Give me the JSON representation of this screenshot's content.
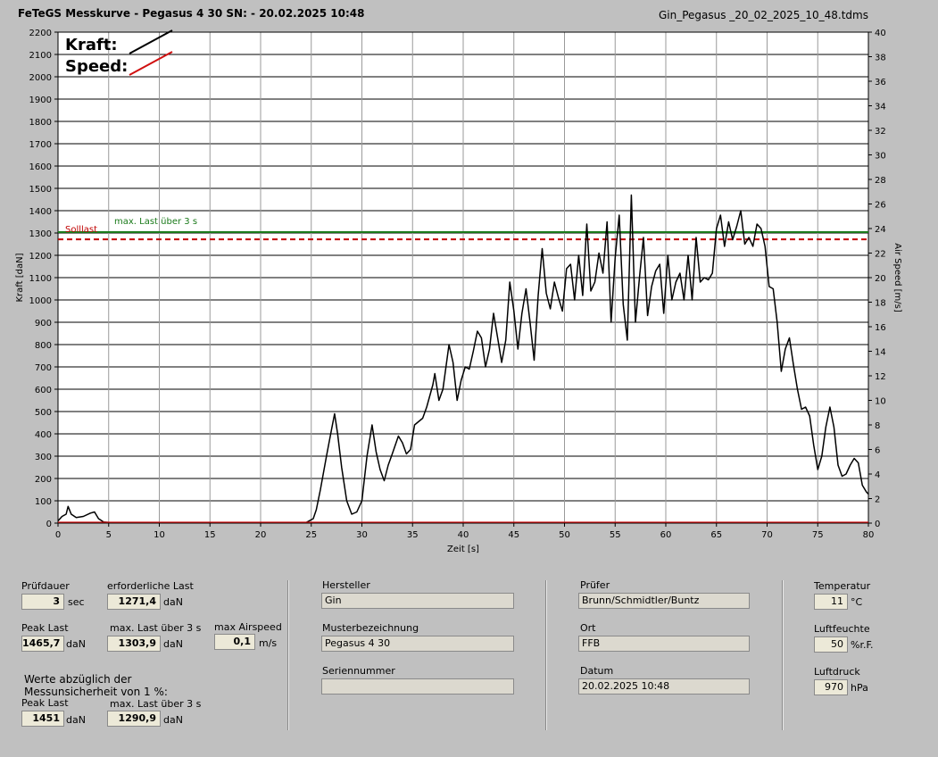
{
  "header": {
    "title": "FeTeGS Messkurve - Pegasus 4 30  SN:  - 20.02.2025 10:48",
    "filename": "Gin_Pegasus _20_02_2025_10_48.tdms"
  },
  "chart_data": {
    "type": "line",
    "xlabel": "Zeit [s]",
    "ylabel_left": "Kraft [daN]",
    "ylabel_right": "Air Speed [m/s]",
    "xlim": [
      0,
      80
    ],
    "ylim_left": [
      0,
      2200
    ],
    "ylim_right": [
      0,
      40
    ],
    "xticks": [
      "0",
      "5",
      "10",
      "15",
      "20",
      "25",
      "30",
      "35",
      "40",
      "45",
      "50",
      "55",
      "60",
      "65",
      "70",
      "75",
      "80"
    ],
    "yticks_left": [
      "0",
      "100",
      "200",
      "300",
      "400",
      "500",
      "600",
      "700",
      "800",
      "900",
      "1000",
      "1100",
      "1200",
      "1300",
      "1400",
      "1500",
      "1600",
      "1700",
      "1800",
      "1900",
      "2000",
      "2100",
      "2200"
    ],
    "yticks_right": [
      "0",
      "2",
      "4",
      "6",
      "8",
      "10",
      "12",
      "14",
      "16",
      "18",
      "20",
      "22",
      "24",
      "26",
      "28",
      "30",
      "32",
      "34",
      "36",
      "38",
      "40"
    ],
    "legend": [
      {
        "name": "Kraft:",
        "color": "#000000"
      },
      {
        "name": "Speed:",
        "color": "#d01010"
      }
    ],
    "legend_position": "top-left",
    "grid": true,
    "series": [
      {
        "name": "Kraft",
        "color": "#000000",
        "points": [
          [
            0,
            10
          ],
          [
            0.4,
            30
          ],
          [
            0.8,
            40
          ],
          [
            1.0,
            75
          ],
          [
            1.3,
            40
          ],
          [
            1.8,
            25
          ],
          [
            2.5,
            30
          ],
          [
            3.2,
            45
          ],
          [
            3.6,
            50
          ],
          [
            4.0,
            20
          ],
          [
            4.5,
            5
          ],
          [
            5,
            3
          ],
          [
            10,
            3
          ],
          [
            15,
            3
          ],
          [
            20,
            3
          ],
          [
            24.5,
            3
          ],
          [
            25.2,
            20
          ],
          [
            25.5,
            60
          ],
          [
            25.9,
            150
          ],
          [
            26.5,
            300
          ],
          [
            27.0,
            420
          ],
          [
            27.3,
            490
          ],
          [
            27.6,
            400
          ],
          [
            28.0,
            250
          ],
          [
            28.5,
            100
          ],
          [
            29.0,
            40
          ],
          [
            29.5,
            50
          ],
          [
            30.0,
            100
          ],
          [
            30.5,
            300
          ],
          [
            31.0,
            440
          ],
          [
            31.4,
            320
          ],
          [
            31.8,
            240
          ],
          [
            32.2,
            190
          ],
          [
            32.6,
            260
          ],
          [
            33.0,
            310
          ],
          [
            33.6,
            390
          ],
          [
            34.0,
            360
          ],
          [
            34.4,
            310
          ],
          [
            34.8,
            330
          ],
          [
            35.2,
            440
          ],
          [
            36.0,
            470
          ],
          [
            36.4,
            520
          ],
          [
            37.0,
            620
          ],
          [
            37.2,
            670
          ],
          [
            37.6,
            550
          ],
          [
            38.0,
            600
          ],
          [
            38.6,
            800
          ],
          [
            39.0,
            720
          ],
          [
            39.4,
            550
          ],
          [
            39.8,
            640
          ],
          [
            40.2,
            700
          ],
          [
            40.6,
            690
          ],
          [
            41.0,
            770
          ],
          [
            41.4,
            860
          ],
          [
            41.8,
            830
          ],
          [
            42.2,
            700
          ],
          [
            42.6,
            780
          ],
          [
            43.0,
            940
          ],
          [
            43.4,
            830
          ],
          [
            43.8,
            720
          ],
          [
            44.2,
            820
          ],
          [
            44.6,
            1080
          ],
          [
            45.0,
            950
          ],
          [
            45.4,
            780
          ],
          [
            45.8,
            940
          ],
          [
            46.2,
            1050
          ],
          [
            46.6,
            900
          ],
          [
            47.0,
            730
          ],
          [
            47.4,
            1020
          ],
          [
            47.8,
            1230
          ],
          [
            48.2,
            1030
          ],
          [
            48.6,
            960
          ],
          [
            49.0,
            1080
          ],
          [
            49.4,
            1010
          ],
          [
            49.8,
            950
          ],
          [
            50.2,
            1140
          ],
          [
            50.6,
            1160
          ],
          [
            51.0,
            1000
          ],
          [
            51.4,
            1200
          ],
          [
            51.8,
            1020
          ],
          [
            52.2,
            1340
          ],
          [
            52.6,
            1040
          ],
          [
            53.0,
            1080
          ],
          [
            53.4,
            1210
          ],
          [
            53.8,
            1120
          ],
          [
            54.2,
            1350
          ],
          [
            54.6,
            900
          ],
          [
            55.0,
            1190
          ],
          [
            55.4,
            1380
          ],
          [
            55.8,
            980
          ],
          [
            56.2,
            820
          ],
          [
            56.6,
            1470
          ],
          [
            57.0,
            900
          ],
          [
            57.4,
            1100
          ],
          [
            57.8,
            1280
          ],
          [
            58.2,
            930
          ],
          [
            58.6,
            1060
          ],
          [
            59.0,
            1130
          ],
          [
            59.4,
            1160
          ],
          [
            59.8,
            940
          ],
          [
            60.2,
            1200
          ],
          [
            60.6,
            1000
          ],
          [
            61.0,
            1080
          ],
          [
            61.4,
            1120
          ],
          [
            61.8,
            1000
          ],
          [
            62.2,
            1200
          ],
          [
            62.6,
            1000
          ],
          [
            63.0,
            1280
          ],
          [
            63.4,
            1080
          ],
          [
            63.8,
            1100
          ],
          [
            64.2,
            1090
          ],
          [
            64.6,
            1120
          ],
          [
            65.0,
            1320
          ],
          [
            65.4,
            1380
          ],
          [
            65.8,
            1240
          ],
          [
            66.2,
            1350
          ],
          [
            66.6,
            1270
          ],
          [
            67.0,
            1330
          ],
          [
            67.4,
            1400
          ],
          [
            67.8,
            1250
          ],
          [
            68.2,
            1280
          ],
          [
            68.6,
            1240
          ],
          [
            69.0,
            1340
          ],
          [
            69.4,
            1320
          ],
          [
            69.8,
            1240
          ],
          [
            70.2,
            1060
          ],
          [
            70.6,
            1050
          ],
          [
            71.0,
            900
          ],
          [
            71.4,
            680
          ],
          [
            71.8,
            780
          ],
          [
            72.2,
            830
          ],
          [
            72.6,
            710
          ],
          [
            73.0,
            600
          ],
          [
            73.4,
            510
          ],
          [
            73.8,
            520
          ],
          [
            74.2,
            480
          ],
          [
            74.6,
            350
          ],
          [
            75.0,
            240
          ],
          [
            75.4,
            300
          ],
          [
            75.8,
            430
          ],
          [
            76.2,
            520
          ],
          [
            76.6,
            430
          ],
          [
            77.0,
            260
          ],
          [
            77.4,
            210
          ],
          [
            77.8,
            220
          ],
          [
            78.2,
            260
          ],
          [
            78.6,
            290
          ],
          [
            79.0,
            270
          ],
          [
            79.4,
            170
          ],
          [
            79.8,
            140
          ],
          [
            80.0,
            130
          ]
        ]
      },
      {
        "name": "Speed",
        "color": "#d01010",
        "points": [
          [
            0,
            0
          ],
          [
            80,
            0
          ]
        ]
      }
    ],
    "reference_lines": [
      {
        "label": "Solllast",
        "value": 1271.4,
        "color": "#c00000",
        "style": "dashed"
      },
      {
        "label": "max. Last über  3 s",
        "value": 1303.9,
        "color": "#1a7a1a",
        "style": "solid"
      }
    ]
  },
  "summary": {
    "pruefdauer_label": "Prüfdauer",
    "pruefdauer_value": "3",
    "pruefdauer_unit": "sec",
    "erf_last_label": "erforderliche Last",
    "erf_last_value": "1271,4",
    "erf_last_unit": "daN",
    "peak_last_label": "Peak Last",
    "peak_last_value": "1465,7",
    "peak_last_unit": "daN",
    "max_last_label": "max. Last über  3 s",
    "max_last_value": "1303,9",
    "max_last_unit": "daN",
    "max_airspeed_label": "max Airspeed",
    "max_airspeed_value": "0,1",
    "max_airspeed_unit": "m/s",
    "werte_label_1": "Werte abzüglich der",
    "werte_label_2": "Messunsicherheit von 1  %:",
    "peak_last2_label": "Peak Last",
    "peak_last2_value": "1451",
    "peak_last2_unit": "daN",
    "max_last2_label": "max. Last über  3 s",
    "max_last2_value": "1290,9",
    "max_last2_unit": "daN"
  },
  "info": {
    "hersteller_label": "Hersteller",
    "hersteller_value": "Gin",
    "muster_label": "Musterbezeichnung",
    "muster_value": "Pegasus 4 30",
    "serien_label": "Seriennummer",
    "serien_value": "",
    "pruefer_label": "Prüfer",
    "pruefer_value": "Brunn/Schmidtler/Buntz",
    "ort_label": "Ort",
    "ort_value": "FFB",
    "datum_label": "Datum",
    "datum_value": "20.02.2025 10:48"
  },
  "env": {
    "temp_label": "Temperatur",
    "temp_value": "11",
    "temp_unit": "°C",
    "feuchte_label": "Luftfeuchte",
    "feuchte_value": "50",
    "feuchte_unit": "%r.F.",
    "druck_label": "Luftdruck",
    "druck_value": "970",
    "druck_unit": "hPa"
  }
}
